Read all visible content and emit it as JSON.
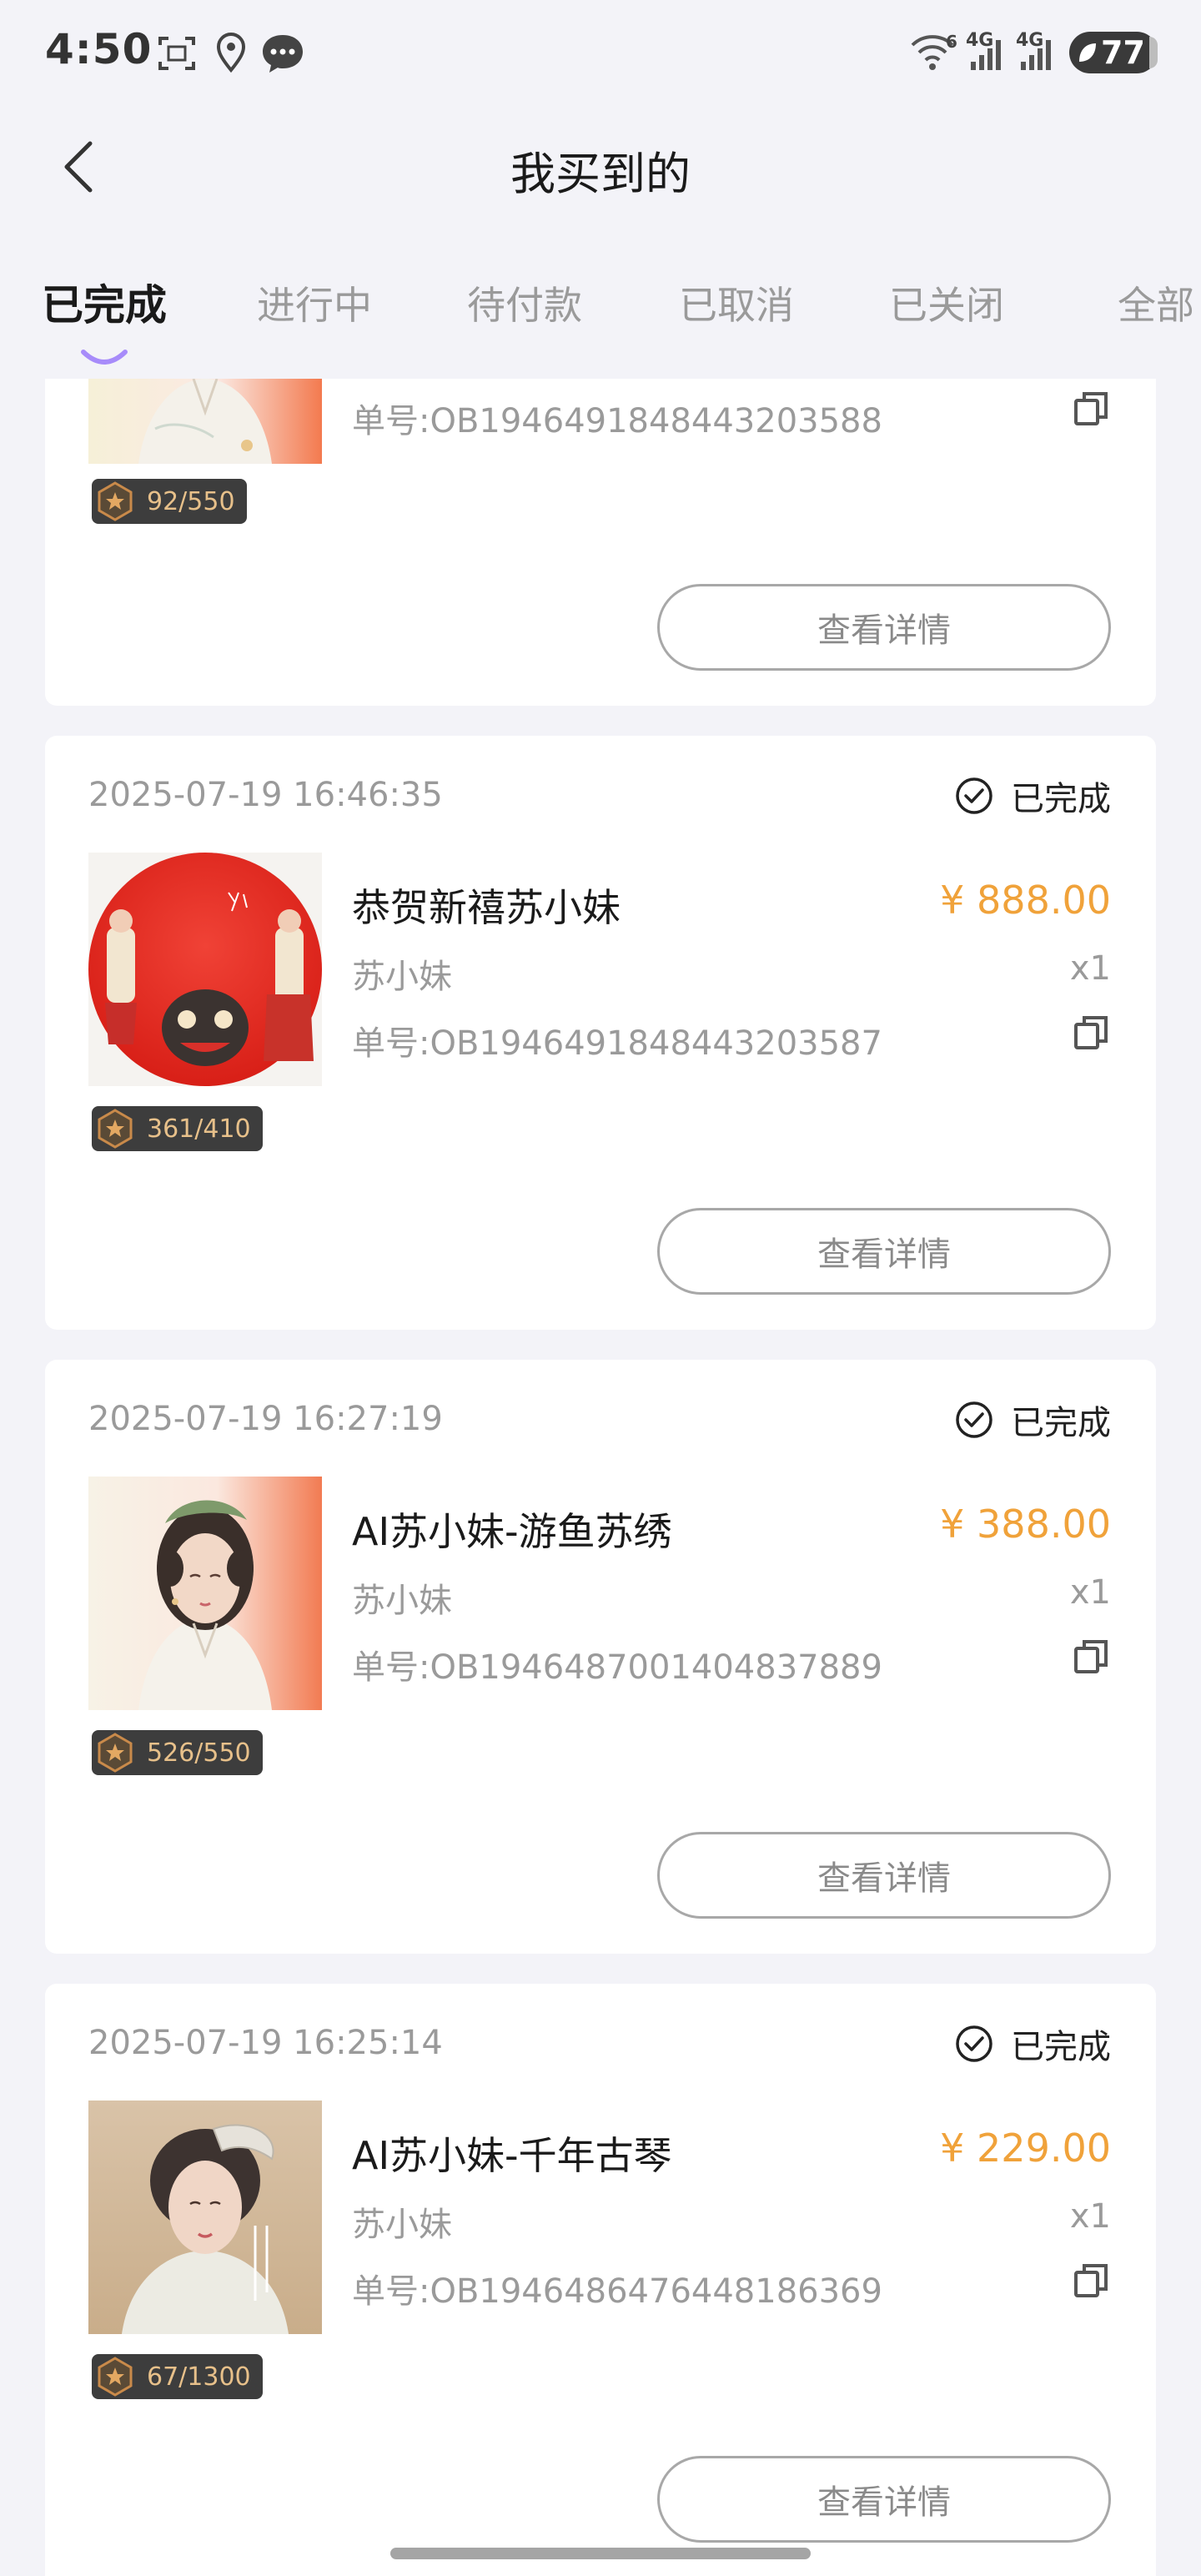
{
  "status_bar": {
    "time": "4:50",
    "battery": "77",
    "network_labels": [
      "4G",
      "4G"
    ],
    "wifi_label": "6"
  },
  "header": {
    "title": "我买到的"
  },
  "tabs": [
    {
      "label": "已完成",
      "active": true
    },
    {
      "label": "进行中",
      "active": false
    },
    {
      "label": "待付款",
      "active": false
    },
    {
      "label": "已取消",
      "active": false
    },
    {
      "label": "已关闭",
      "active": false
    },
    {
      "label": "全部",
      "active": false
    }
  ],
  "colors": {
    "accent_indicator": "#a78bfa",
    "price": "#f0a23a",
    "badge_bg": "#3d3d3d",
    "badge_text": "#e7c08a"
  },
  "orders": [
    {
      "order_no": "单号:OB1946491848443203588",
      "edition": "92/550",
      "detail_label": "查看详情",
      "thumbnail": "portrait-woman-white-dress"
    },
    {
      "date": "2025-07-19 16:46:35",
      "status": "已完成",
      "title": "恭贺新禧苏小妹",
      "price": "¥ 888.00",
      "seller": "苏小妹",
      "qty": "x1",
      "order_no": "单号:OB1946491848443203587",
      "edition": "361/410",
      "detail_label": "查看详情",
      "thumbnail": "red-circle-new-year"
    },
    {
      "date": "2025-07-19 16:27:19",
      "status": "已完成",
      "title": "AI苏小妹-游鱼苏绣",
      "price": "¥ 388.00",
      "seller": "苏小妹",
      "qty": "x1",
      "order_no": "单号:OB1946487001404837889",
      "edition": "526/550",
      "detail_label": "查看详情",
      "thumbnail": "portrait-woman-white-dress"
    },
    {
      "date": "2025-07-19 16:25:14",
      "status": "已完成",
      "title": "AI苏小妹-千年古琴",
      "price": "¥ 229.00",
      "seller": "苏小妹",
      "qty": "x1",
      "order_no": "单号:OB1946486476448186369",
      "edition": "67/1300",
      "detail_label": "查看详情",
      "thumbnail": "portrait-woman-guqin"
    }
  ]
}
